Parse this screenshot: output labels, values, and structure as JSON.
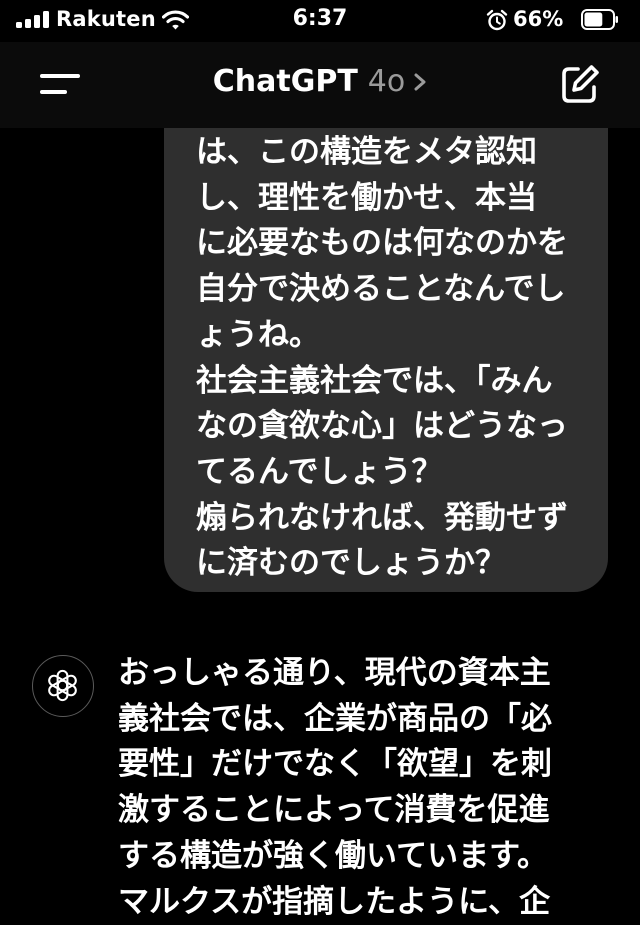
{
  "status_bar": {
    "carrier": "Rakuten",
    "time": "6:37",
    "battery_percent": "66%",
    "signal_icon": "signal-bars-icon",
    "wifi_icon": "wifi-icon",
    "alarm_icon": "alarm-clock-icon",
    "battery_icon": "battery-icon",
    "battery_level": 0.66
  },
  "nav": {
    "title": "ChatGPT",
    "model": "4o",
    "menu_icon": "menu-icon",
    "chevron_icon": "chevron-right-icon",
    "compose_icon": "new-chat-icon"
  },
  "conversation": {
    "user_message_lines": [
      "は、この構造をメタ認知",
      "し、理性を働かせ、本当",
      "に必要なものは何なのかを",
      "自分で決めることなんでし",
      "ょうね。",
      "社会主義社会では、「みん",
      "なの貪欲な心」はどうなっ",
      "てるんでしょう？",
      "煽られなければ、発動せず",
      "に済むのでしょうか？"
    ],
    "assistant_avatar_icon": "chatgpt-logo-icon",
    "assistant_message_lines": [
      "おっしゃる通り、現代の資本主",
      "義社会では、企業が商品の「必",
      "要性」だけでなく「欲望」を刺",
      "激することによって消費を促進",
      "する構造が強く働いています。",
      "マルクスが指摘したように、企"
    ]
  },
  "colors": {
    "background": "#000000",
    "header_background": "#0b0b0b",
    "user_bubble": "#2f2f2f",
    "text": "#ffffff",
    "muted_text": "#9b9b9b"
  }
}
